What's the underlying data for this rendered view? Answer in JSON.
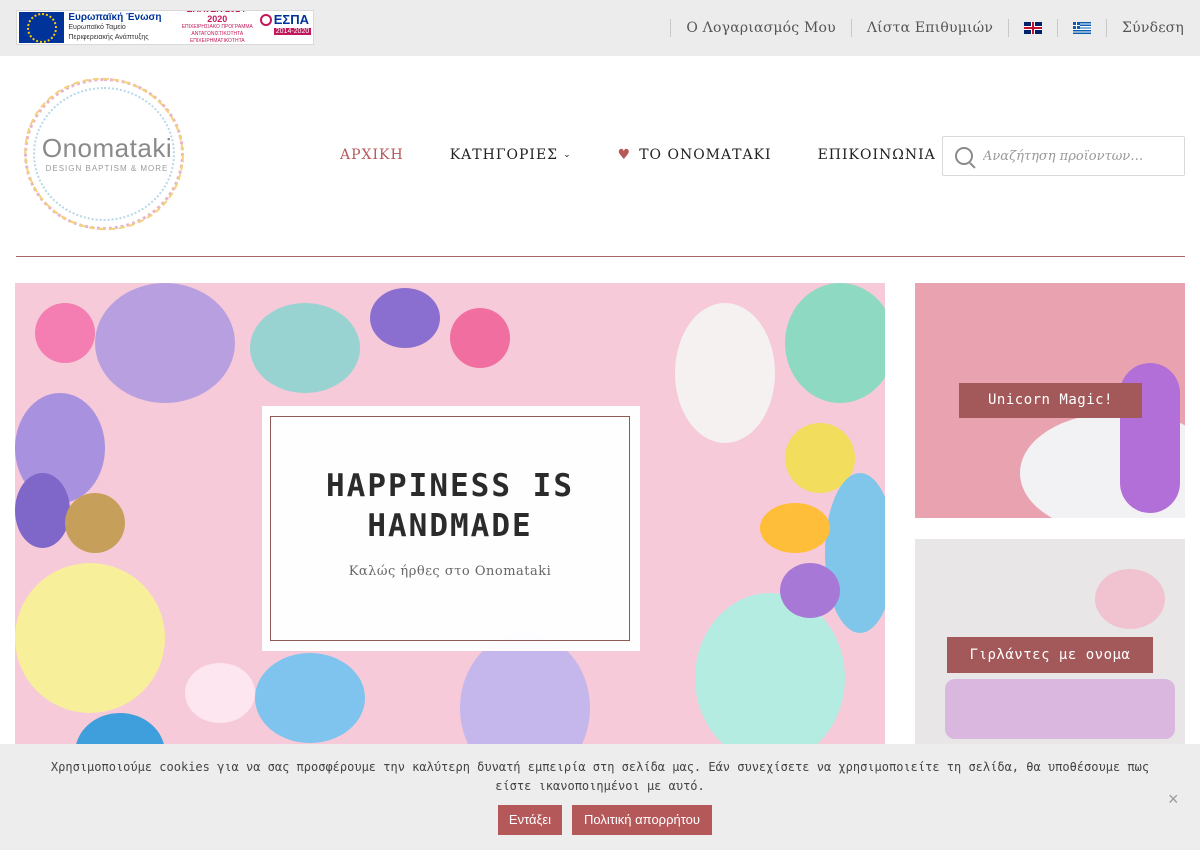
{
  "topbar": {
    "eu_banner": {
      "title": "Ευρωπαϊκή Ένωση",
      "line1": "Ευρωπαϊκό Ταμείο",
      "line2": "Περιφερειακής Ανάπτυξης",
      "epanek": "ΕΠΑνΕΚ 2014-2020",
      "epanek_sub": "ΕΠΙΧΕΙΡΗΣΙΑΚΟ ΠΡΟΓΡΑΜΜΑ ΑΝΤΑΓΩΝΙΣΤΙΚΟΤΗΤΑ ΕΠΙΧΕΙΡΗΜΑΤΙΚΟΤΗΤΑ ΚΑΙΝΟΤΟΜΙΑ",
      "espa": "ΕΣΠΑ",
      "espa_years": "2014-2020"
    },
    "links": {
      "account": "Ο Λογαριασμός Μου",
      "wishlist": "Λίστα Επιθυμιών",
      "login": "Σύνδεση"
    },
    "languages": [
      "english-flag",
      "greek-flag"
    ]
  },
  "header": {
    "logo": {
      "title": "Onomataki",
      "subtitle": "DESIGN BAPTISM & MORE"
    },
    "nav": {
      "home": "ΑΡΧΙΚΗ",
      "categories": "ΚΑΤΗΓΟΡΙΕΣ",
      "about": "ΤΟ ΟΝΟΜΑΤΑΚΙ",
      "contact": "ΕΠΙΚΟΙΝΩΝΙΑ"
    },
    "search": {
      "placeholder": "Αναζήτηση προϊοντων…"
    }
  },
  "hero": {
    "title_line1": "HAPPINESS IS",
    "title_line2": "HANDMADE",
    "subtitle": "Καλώς ήρθες στο Onomataki"
  },
  "side_banners": {
    "banner1": "Unicorn Magic!",
    "banner2": "Γιρλάντες με ονομα"
  },
  "cookie": {
    "text": "Χρησιμοποιούμε cookies για να σας προσφέρουμε την καλύτερη δυνατή εμπειρία στη σελίδα μας. Εάν συνεχίσετε να χρησιμοποιείτε τη σελίδα, θα υποθέσουμε πως είστε ικανοποιημένοι με αυτό.",
    "accept": "Εντάξει",
    "policy": "Πολιτική απορρήτου",
    "close": "×"
  },
  "colors": {
    "accent": "#b5585a",
    "topbar_bg": "#ececec",
    "hero_bg": "#f7cad9"
  }
}
